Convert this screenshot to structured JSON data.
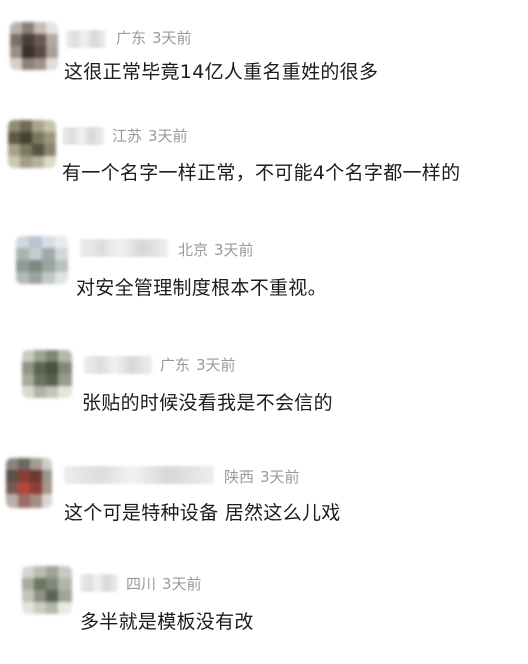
{
  "comments": [
    {
      "location": "广东",
      "time": "3天前",
      "text": "这很正常毕竟14亿人重名重姓的很多"
    },
    {
      "location": "江苏",
      "time": "3天前",
      "text": "有一个名字一样正常，不可能4个名字都一样的"
    },
    {
      "location": "北京",
      "time": "3天前",
      "text": "对安全管理制度根本不重视。"
    },
    {
      "location": "广东",
      "time": "3天前",
      "text": "张贴的时候没看我是不会信的"
    },
    {
      "location": "陕西",
      "time": "3天前",
      "text": "这个可是特种设备 居然这么儿戏"
    },
    {
      "location": "四川",
      "time": "3天前",
      "text": "多半就是模板没有改"
    }
  ],
  "colors": {
    "meta": "#9a9a9a",
    "text": "#1c1c1c",
    "background": "#ffffff"
  }
}
